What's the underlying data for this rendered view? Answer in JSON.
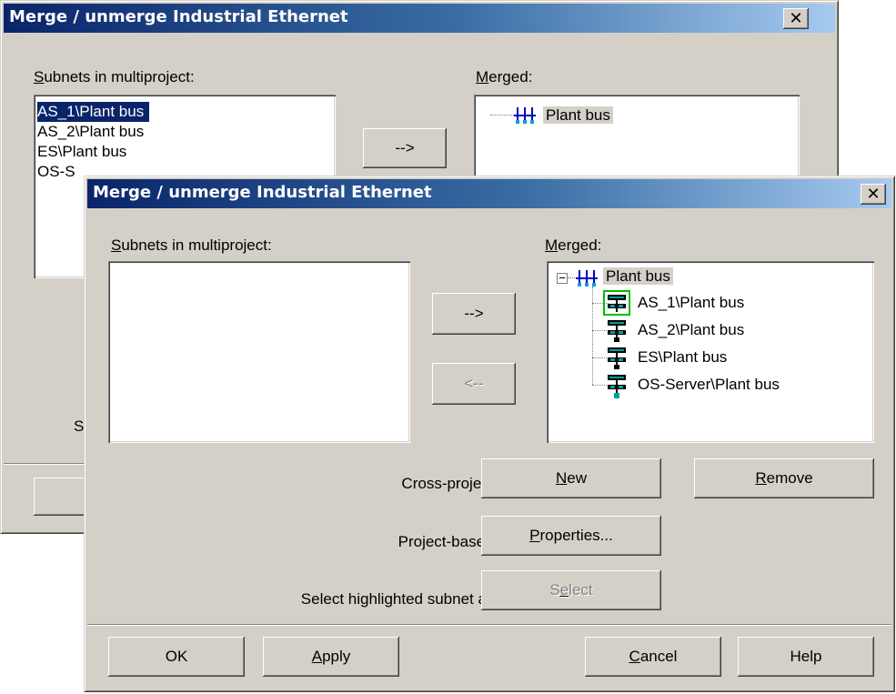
{
  "back_dialog": {
    "title": "Merge / unmerge Industrial Ethernet",
    "close": "✕",
    "subnets_label_prefix": "S",
    "subnets_label_rest": "ubnets in multiproject:",
    "merged_label_prefix": "M",
    "merged_label_rest": "erged:",
    "subnets": [
      "AS_1\\Plant bus",
      "AS_2\\Plant bus",
      "ES\\Plant bus",
      "OS-S"
    ],
    "add_button_text": "-->",
    "merged_root": "Plant bus",
    "partial_label": "S"
  },
  "front_dialog": {
    "title": "Merge / unmerge Industrial Ethernet",
    "close": "✕",
    "subnets_label_prefix": "S",
    "subnets_label_rest": "ubnets in multiproject:",
    "merged_label_prefix": "M",
    "merged_label_rest": "erged:",
    "add_button": "-->",
    "remove_button": "<--",
    "merged_tree": {
      "root": "Plant bus",
      "children": [
        "AS_1\\Plant bus",
        "AS_2\\Plant bus",
        "ES\\Plant bus",
        "OS-Server\\Plant bus"
      ]
    },
    "cross_project_label": "Cross-project subnet:",
    "project_based_label": "Project-based subnet:",
    "leading_label": "Select highlighted subnet as leading",
    "new_button": {
      "u": "N",
      "rest": "ew"
    },
    "remove_subnet_button": {
      "u": "R",
      "rest": "emove"
    },
    "properties_button": {
      "u": "P",
      "rest": "roperties..."
    },
    "select_button": {
      "pre": "S",
      "u": "e",
      "rest": "lect"
    },
    "ok_button": "OK",
    "apply_button": {
      "u": "A",
      "rest": "pply"
    },
    "cancel_button": {
      "u": "C",
      "rest": "ancel"
    },
    "help_button": "Help"
  },
  "colors": {
    "face": "#d4d0c8",
    "title_start": "#0a246a",
    "title_end": "#a6caf0",
    "selection": "#0a246a"
  }
}
